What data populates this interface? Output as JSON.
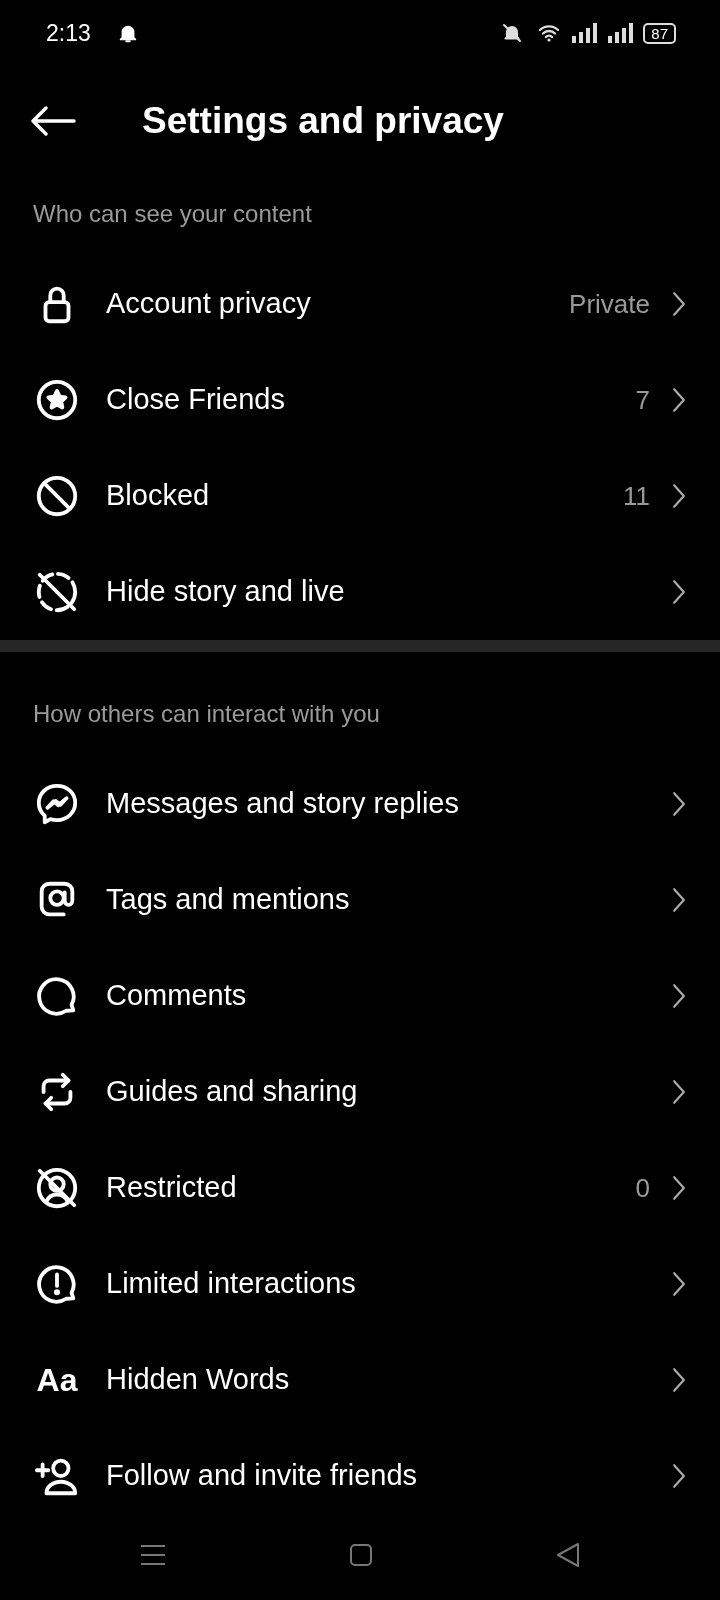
{
  "status_bar": {
    "time": "2:13",
    "battery": "87"
  },
  "header": {
    "title": "Settings and privacy"
  },
  "sections": [
    {
      "heading": "Who can see your content",
      "items": [
        {
          "label": "Account privacy",
          "value": "Private"
        },
        {
          "label": "Close Friends",
          "value": "7"
        },
        {
          "label": "Blocked",
          "value": "11"
        },
        {
          "label": "Hide story and live"
        }
      ]
    },
    {
      "heading": "How others can interact with you",
      "items": [
        {
          "label": "Messages and story replies"
        },
        {
          "label": "Tags and mentions"
        },
        {
          "label": "Comments"
        },
        {
          "label": "Guides and sharing"
        },
        {
          "label": "Restricted",
          "value": "0"
        },
        {
          "label": "Limited interactions"
        },
        {
          "icon_text": "Aa",
          "label": "Hidden Words"
        },
        {
          "label": "Follow and invite friends"
        }
      ]
    }
  ]
}
